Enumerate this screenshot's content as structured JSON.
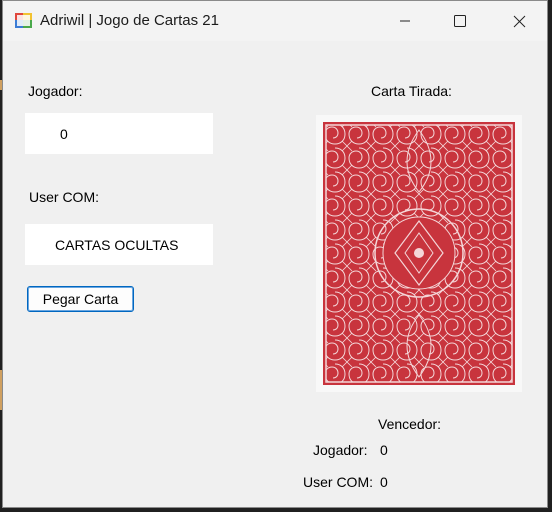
{
  "window": {
    "title": "Adriwil | Jogo de Cartas 21",
    "controls": [
      "minimize-icon",
      "maximize-icon",
      "close-icon"
    ]
  },
  "left_panel": {
    "player_label": "Jogador:",
    "player_value": "0",
    "com_label": "User COM:",
    "com_value": "CARTAS OCULTAS",
    "draw_button": "Pegar Carta"
  },
  "right_panel": {
    "drawn_card_label": "Carta Tirada:",
    "card_image": "card-back-red-ornate",
    "winner_label": "Vencedor:",
    "player_score_label": "Jogador:",
    "player_score_value": "0",
    "com_score_label": "User COM:",
    "com_score_value": "0"
  },
  "colors": {
    "card_red": "#c8343d",
    "button_border": "#0067c0"
  }
}
